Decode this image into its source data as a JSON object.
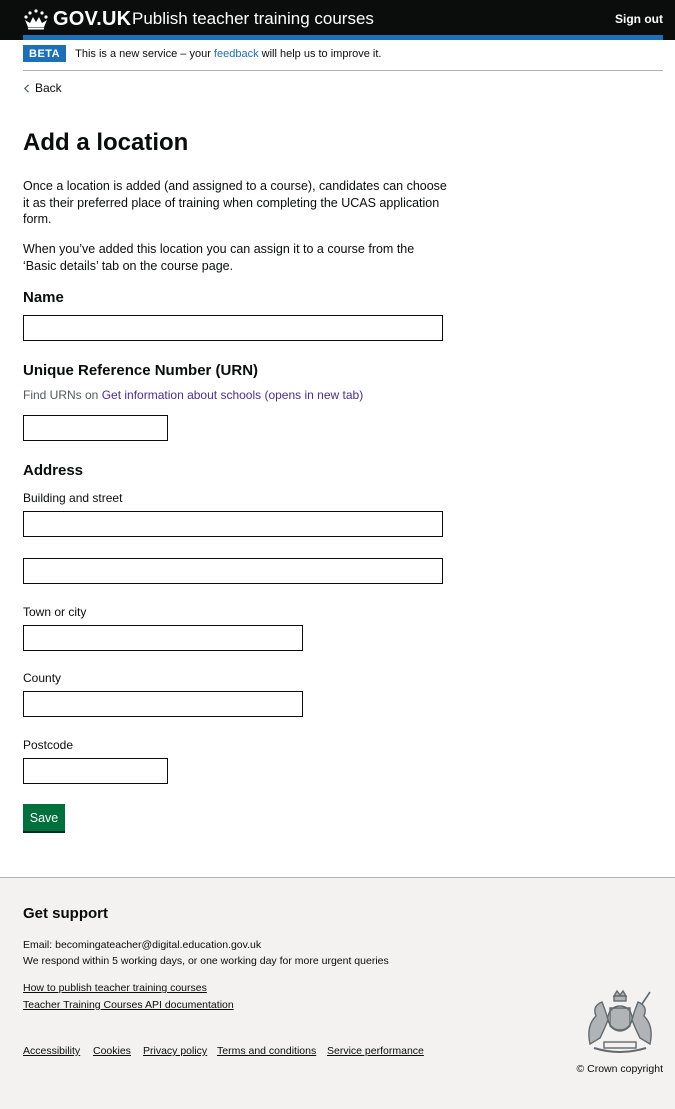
{
  "header": {
    "logo_text": "GOV.UK",
    "service_name": "Publish teacher training courses",
    "sign_out": "Sign out",
    "accent_color": "#1d70b8"
  },
  "phase_banner": {
    "tag": "BETA",
    "text_before": "This is a new service – your",
    "link": "feedback",
    "text_after": "will help us to improve it."
  },
  "back_link": "Back",
  "page": {
    "title": "Add a location",
    "intro_1": "Once a location is added (and assigned to a course), candidates can choose it as their preferred place of training when completing the UCAS application form.",
    "intro_2": "When you’ve added this location you can assign it to a course from the ‘Basic details’ tab on the course page."
  },
  "form": {
    "name_label": "Name",
    "name_value": "",
    "urn_label": "Unique Reference Number (URN)",
    "urn_hint_prefix": "Find URNs on",
    "urn_hint_link": "Get information about schools (opens in new tab)",
    "urn_value": "",
    "address_label": "Address",
    "building_label": "Building and street",
    "building_line1_value": "",
    "building_line2_value": "",
    "town_label": "Town or city",
    "town_value": "",
    "county_label": "County",
    "county_value": "",
    "postcode_label": "Postcode",
    "postcode_value": "",
    "save_button": "Save",
    "save_color": "#00703c"
  },
  "footer": {
    "heading": "Get support",
    "email_label": "Email:",
    "email": "becomingateacher@digital.education.gov.uk",
    "response_text": "We respond within 5 working days, or one working day for more urgent queries",
    "link_1": "How to publish teacher training courses",
    "link_2": "Teacher Training Courses API documentation",
    "meta_links": [
      "Accessibility",
      "Cookies",
      "Privacy policy",
      "Terms and conditions",
      "Service performance"
    ],
    "copyright": "© Crown copyright",
    "background_color": "#f3f2f1"
  }
}
